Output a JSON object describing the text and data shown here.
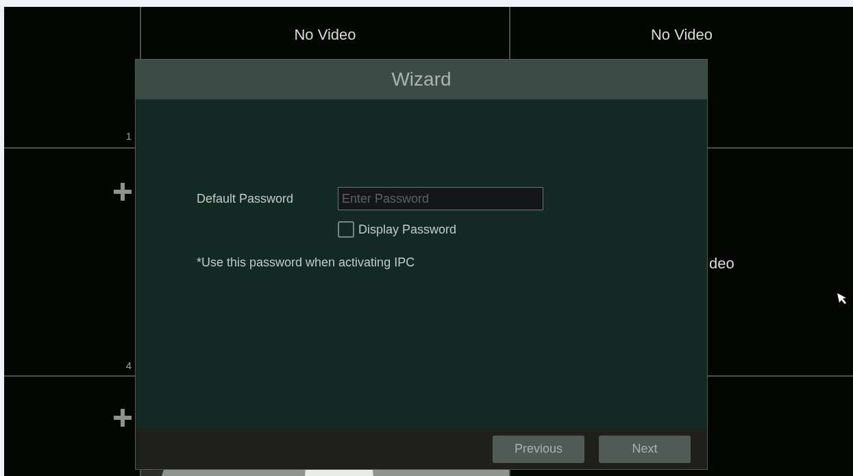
{
  "video_grid": [
    {
      "kind": "slot",
      "channel": "1"
    },
    {
      "kind": "no_video",
      "label": "No Video"
    },
    {
      "kind": "no_video",
      "label": "No Video"
    },
    {
      "kind": "add",
      "channel": "4"
    },
    {
      "kind": "blank"
    },
    {
      "kind": "no_video",
      "label": "deo"
    },
    {
      "kind": "add"
    },
    {
      "kind": "picture"
    },
    {
      "kind": "blank"
    }
  ],
  "dialog": {
    "title": "Wizard",
    "password": {
      "label": "Default Password",
      "placeholder": "Enter Password"
    },
    "display_password": {
      "label": "Display Password",
      "checked": false
    },
    "note": "*Use this password when activating IPC",
    "buttons": [
      "Previous",
      "Next"
    ]
  }
}
